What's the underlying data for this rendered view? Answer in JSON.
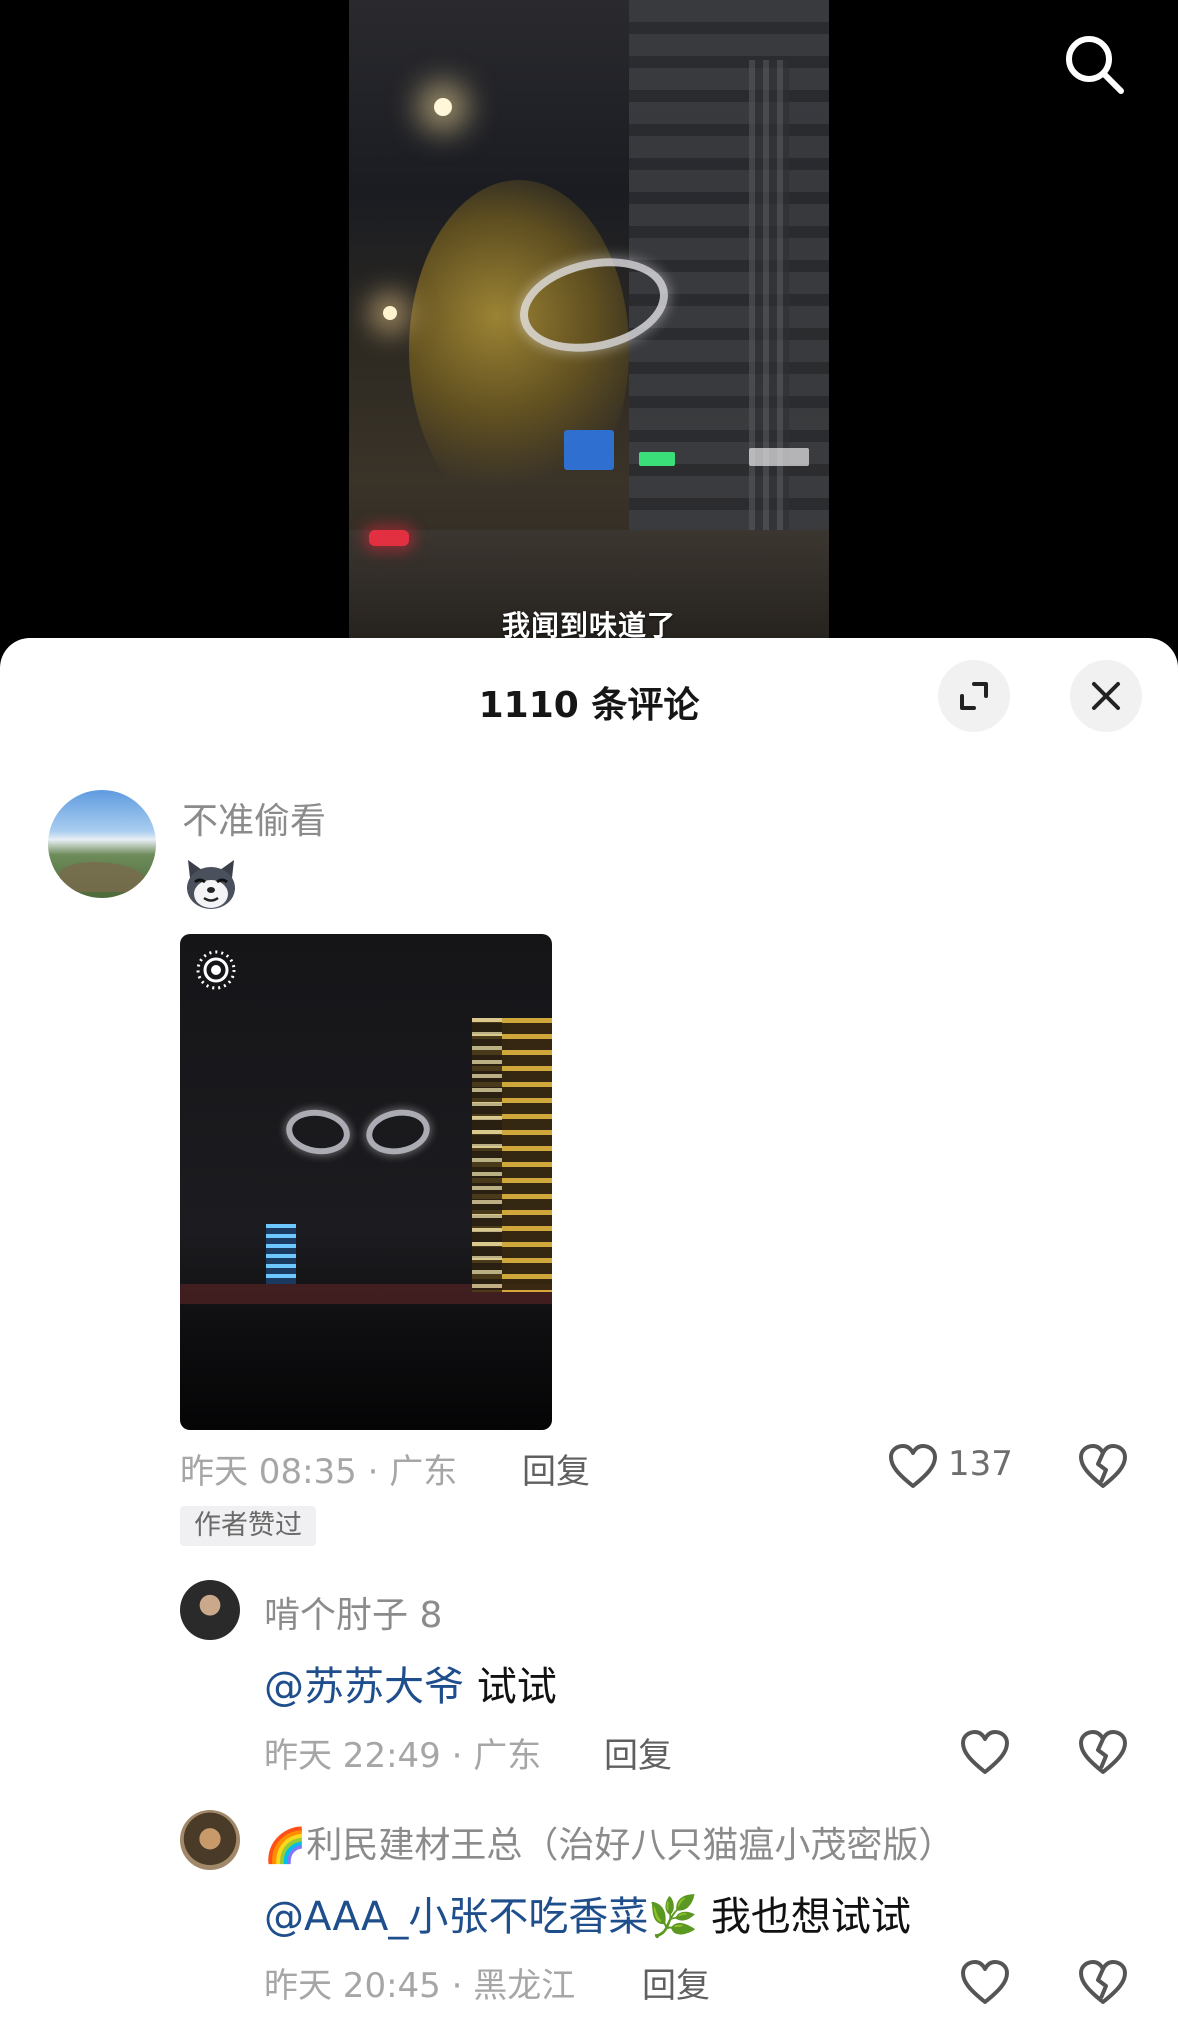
{
  "video": {
    "subtitle": "我闻到味道了"
  },
  "icons": {
    "search": "search-icon",
    "expand": "expand-icon",
    "close": "close-icon",
    "like": "heart-icon",
    "dislike": "broken-heart-icon",
    "live_photo": "live-photo-icon",
    "sticker": "cat-sticker"
  },
  "comments_panel": {
    "title": "1110 条评论"
  },
  "comment": {
    "username": "不准偷看",
    "time": "昨天 08:35 · 广东",
    "reply_label": "回复",
    "likes": "137",
    "author_badge": "作者赞过"
  },
  "replies": [
    {
      "username": "啃个肘子 8",
      "mention": "@苏苏大爷",
      "text": " 试试",
      "time": "昨天 22:49 · 广东",
      "reply_label": "回复"
    },
    {
      "username_prefix": "🌈",
      "username": "利民建材王总（治好八只猫瘟小茂密版）",
      "mention": "@AAA_小张不吃香菜🌿",
      "text": " 我也想试试",
      "time": "昨天 20:45 · 黑龙江",
      "reply_label": "回复"
    }
  ],
  "colors": {
    "mention": "#1f4e8c",
    "meta_text": "#a6a6a6",
    "sheet_bg": "#ffffff"
  }
}
